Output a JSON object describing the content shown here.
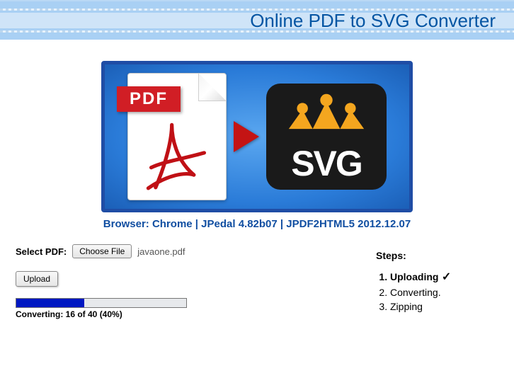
{
  "header": {
    "title": "Online PDF to SVG Converter"
  },
  "hero": {
    "pdf_badge": "PDF",
    "svg_text": "SVG"
  },
  "meta": "Browser: Chrome | JPedal 4.82b07 | JPDF2HTML5 2012.12.07",
  "controls": {
    "select_label": "Select PDF:",
    "choose_file_label": "Choose File",
    "file_name": "javaone.pdf",
    "upload_label": "Upload"
  },
  "progress": {
    "percent": 40,
    "text": "Converting: 16 of 40 (40%)"
  },
  "steps": {
    "title": "Steps:",
    "items": [
      {
        "label": "Uploading",
        "done": true
      },
      {
        "label": "Converting.",
        "done": false
      },
      {
        "label": "Zipping",
        "done": false
      }
    ],
    "active_index": 0
  }
}
